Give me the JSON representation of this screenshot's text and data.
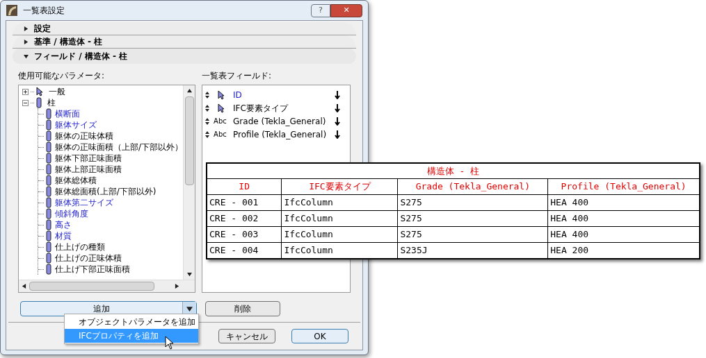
{
  "window": {
    "title": "一覧表設定",
    "help": "?",
    "close": "✕"
  },
  "sections": [
    {
      "label": "設定",
      "expanded": false
    },
    {
      "label": "基準 /  構造体 - 柱",
      "expanded": false
    },
    {
      "label": "フィールド /  構造体 - 柱",
      "expanded": true
    }
  ],
  "available_parameters": {
    "label": "使用可能なパラメータ:",
    "tree": [
      {
        "label": "一般",
        "kind": "pointer",
        "expanded": false,
        "highlighted": false
      },
      {
        "label": "柱",
        "kind": "column",
        "expanded": true,
        "highlighted": false,
        "children": [
          {
            "label": "横断面",
            "kind": "column",
            "highlighted": true
          },
          {
            "label": "躯体サイズ",
            "kind": "column",
            "highlighted": true
          },
          {
            "label": "躯体の正味体積",
            "kind": "column",
            "highlighted": false
          },
          {
            "label": "躯体の正味面積（上部/下部以外）",
            "kind": "column",
            "highlighted": false
          },
          {
            "label": "躯体下部正味面積",
            "kind": "column",
            "highlighted": false
          },
          {
            "label": "躯体上部正味面積",
            "kind": "column",
            "highlighted": false
          },
          {
            "label": "躯体総体積",
            "kind": "column",
            "highlighted": false
          },
          {
            "label": "躯体総面積(上部/下部以外)",
            "kind": "column",
            "highlighted": false
          },
          {
            "label": "躯体第二サイズ",
            "kind": "column",
            "highlighted": true
          },
          {
            "label": "傾斜角度",
            "kind": "column",
            "highlighted": true
          },
          {
            "label": "高さ",
            "kind": "column",
            "highlighted": true
          },
          {
            "label": "材質",
            "kind": "column",
            "highlighted": true
          },
          {
            "label": "仕上げの種類",
            "kind": "column",
            "highlighted": false
          },
          {
            "label": "仕上げの正味体積",
            "kind": "column",
            "highlighted": false
          },
          {
            "label": "仕上げ下部正味面積",
            "kind": "column",
            "highlighted": false
          }
        ]
      }
    ]
  },
  "schedule_fields": {
    "label": "一覧表フィールド:",
    "items": [
      {
        "label": "ID",
        "kind": "pointer",
        "highlighted": true
      },
      {
        "label": "IFC要素タイプ",
        "kind": "pointer",
        "highlighted": false
      },
      {
        "label": "Grade (Tekla_General)",
        "kind": "text",
        "highlighted": false,
        "icon_text": "Abc"
      },
      {
        "label": "Profile (Tekla_General)",
        "kind": "text",
        "highlighted": false,
        "icon_text": "Abc"
      }
    ]
  },
  "buttons": {
    "add": "追加",
    "delete": "削除",
    "cancel": "キャンセル",
    "ok": "OK"
  },
  "add_menu": [
    {
      "label": "オブジェクトパラメータを追加",
      "selected": false
    },
    {
      "label": "IFCプロパティを追加",
      "selected": true
    }
  ],
  "schedule_preview": {
    "title": "構造体 - 柱",
    "columns": [
      "ID",
      "IFC要素タイプ",
      "Grade (Tekla_General)",
      "Profile (Tekla_General)"
    ],
    "rows": [
      [
        "CRE - 001",
        "IfcColumn",
        "S275",
        "HEA 400"
      ],
      [
        "CRE - 002",
        "IfcColumn",
        "S275",
        "HEA 400"
      ],
      [
        "CRE - 003",
        "IfcColumn",
        "S275",
        "HEA 400"
      ],
      [
        "CRE - 004",
        "IfcColumn",
        "S235J",
        "HEA 200"
      ]
    ]
  }
}
